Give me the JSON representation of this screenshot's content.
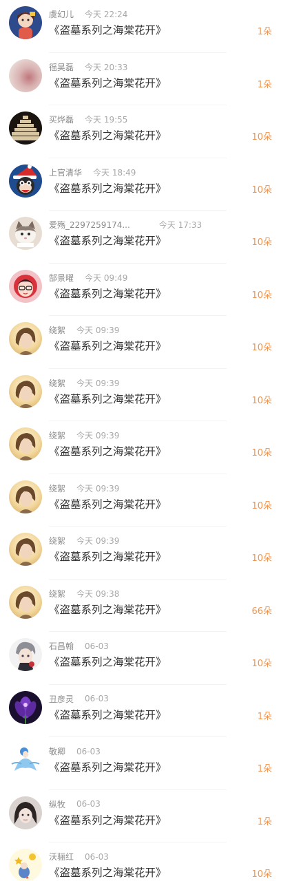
{
  "gifts": [
    {
      "name": "虞幻儿",
      "time": "今天 22:24",
      "title": "《盗墓系列之海棠花开》",
      "count": "1朵",
      "avatar": "cartoon-girl-avatar"
    },
    {
      "name": "徭昊磊",
      "time": "今天 20:33",
      "title": "《盗墓系列之海棠花开》",
      "count": "1朵",
      "avatar": "blurred-pink-avatar"
    },
    {
      "name": "买烨磊",
      "time": "今天 19:55",
      "title": "《盗墓系列之海棠花开》",
      "count": "10朵",
      "avatar": "stacked-boxes-avatar"
    },
    {
      "name": "上官清华",
      "time": "今天 18:49",
      "title": "《盗墓系列之海棠花开》",
      "count": "10朵",
      "avatar": "monkey-santa-hat-avatar"
    },
    {
      "name": "爱殇_2297259174...",
      "time": "今天 17:33",
      "title": "《盗墓系列之海棠花开》",
      "count": "10朵",
      "avatar": "cat-avatar"
    },
    {
      "name": "郜景曜",
      "time": "今天 09:49",
      "title": "《盗墓系列之海棠花开》",
      "count": "10朵",
      "avatar": "anime-red-avatar"
    },
    {
      "name": "绕絮",
      "time": "今天 09:39",
      "title": "《盗墓系列之海棠花开》",
      "count": "10朵",
      "avatar": "portrait-avatar"
    },
    {
      "name": "绕絮",
      "time": "今天 09:39",
      "title": "《盗墓系列之海棠花开》",
      "count": "10朵",
      "avatar": "portrait-avatar"
    },
    {
      "name": "绕絮",
      "time": "今天 09:39",
      "title": "《盗墓系列之海棠花开》",
      "count": "10朵",
      "avatar": "portrait-avatar"
    },
    {
      "name": "绕絮",
      "time": "今天 09:39",
      "title": "《盗墓系列之海棠花开》",
      "count": "10朵",
      "avatar": "portrait-avatar"
    },
    {
      "name": "绕絮",
      "time": "今天 09:39",
      "title": "《盗墓系列之海棠花开》",
      "count": "10朵",
      "avatar": "portrait-avatar"
    },
    {
      "name": "绕絮",
      "time": "今天 09:38",
      "title": "《盗墓系列之海棠花开》",
      "count": "66朵",
      "avatar": "portrait-avatar"
    },
    {
      "name": "石昌翰",
      "time": "06-03",
      "title": "《盗墓系列之海棠花开》",
      "count": "10朵",
      "avatar": "anime-boy-avatar"
    },
    {
      "name": "丑彦灵",
      "time": "06-03",
      "title": "《盗墓系列之海棠花开》",
      "count": "1朵",
      "avatar": "purple-flower-avatar"
    },
    {
      "name": "敬卿",
      "time": "06-03",
      "title": "《盗墓系列之海棠花开》",
      "count": "1朵",
      "avatar": "blue-dress-girl-avatar"
    },
    {
      "name": "纵牧",
      "time": "06-03",
      "title": "《盗墓系列之海棠花开》",
      "count": "1朵",
      "avatar": "girl-photo-avatar"
    },
    {
      "name": "沃骊红",
      "time": "06-03",
      "title": "《盗墓系列之海棠花开》",
      "count": "10朵",
      "avatar": "star-girl-avatar"
    }
  ]
}
